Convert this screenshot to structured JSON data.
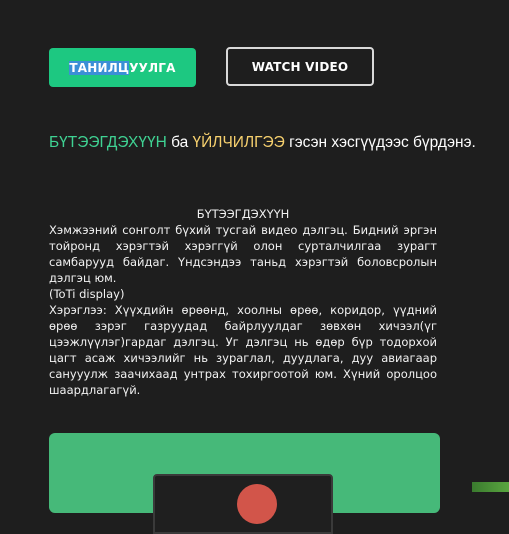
{
  "buttons": {
    "primary_highlight": "ТАНИЛЦ",
    "primary_rest": "УУЛГА",
    "secondary": "WATCH VIDEO"
  },
  "headline": {
    "part1": "БҮТЭЭГДЭХҮҮН",
    "part2": " ба ",
    "part3": "ҮЙЛЧИЛГЭЭ",
    "part4": " гэсэн хэсгүүдээс бүрдэнэ."
  },
  "section": {
    "title": "БҮТЭЭГДЭХҮҮН",
    "paragraph1": "Хэмжээний сонголт бүхий тусгай видео дэлгэц. Бидний эргэн тойронд хэрэгтэй хэрэггүй олон сурталчилгаа зурагт самбарууд байдаг. Үндсэндээ таньд хэрэгтэй боловсролын дэлгэц юм.",
    "paragraph2": "(ToTi display)",
    "paragraph3": "Хэрэглээ: Хүүхдийн өрөөнд, хоолны өрөө, коридор, үүдний өрөө зэрэг газруудад байрлуулдаг зөвхөн хичээл(үг цээжлүүлэг)гардаг дэлгэц. Уг дэлгэц нь өдөр бүр тодорхой цагт асаж хичээлийг нь зураглал, дуудлага, дуу авиагаар санууулж заачихаад унтрах тохиргоотой юм. Хүний оролцоо шаардлагагүй."
  },
  "colors": {
    "accent_green": "#1dc881",
    "headline_green": "#3fd293",
    "headline_yellow": "#f6d06e",
    "card_green": "#46b979"
  }
}
